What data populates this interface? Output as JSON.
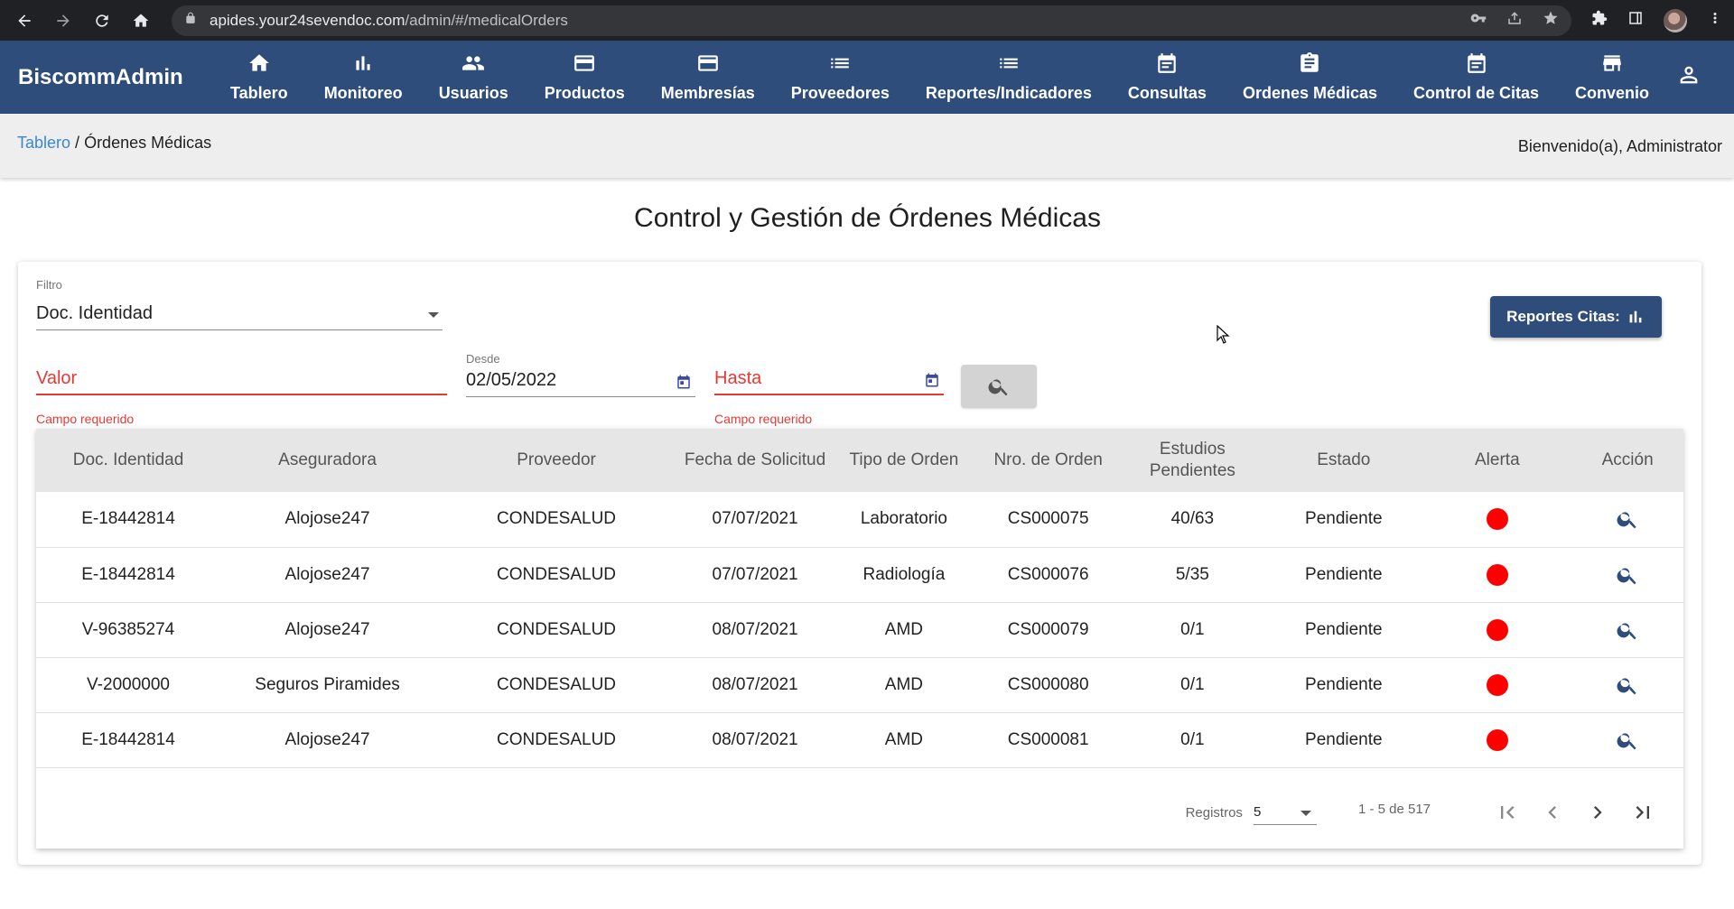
{
  "browser": {
    "url_host": "apides.your24sevendoc.com",
    "url_path": "/admin/#/medicalOrders"
  },
  "app": {
    "brand": "BiscommAdmin",
    "nav": [
      {
        "label": "Tablero",
        "icon": "home-icon"
      },
      {
        "label": "Monitoreo",
        "icon": "bar-chart-icon"
      },
      {
        "label": "Usuarios",
        "icon": "people-icon"
      },
      {
        "label": "Productos",
        "icon": "credit-card-icon"
      },
      {
        "label": "Membresías",
        "icon": "credit-card-icon"
      },
      {
        "label": "Proveedores",
        "icon": "list-icon"
      },
      {
        "label": "Reportes/Indicadores",
        "icon": "list-icon"
      },
      {
        "label": "Consultas",
        "icon": "calendar-icon"
      },
      {
        "label": "Ordenes Médicas",
        "icon": "clipboard-icon"
      },
      {
        "label": "Control de Citas",
        "icon": "calendar-icon"
      },
      {
        "label": "Convenio",
        "icon": "store-icon"
      }
    ]
  },
  "breadcrumb": {
    "home": "Tablero",
    "separator": " / ",
    "current": "Órdenes Médicas"
  },
  "welcome": "Bienvenido(a), Administrator",
  "page_title": "Control y Gestión de Órdenes Médicas",
  "filters": {
    "filter_label": "Filtro",
    "filter_value": "Doc. Identidad",
    "valor_placeholder": "Valor",
    "desde_label": "Desde",
    "desde_value": "02/05/2022",
    "hasta_placeholder": "Hasta",
    "required_msg": "Campo requerido",
    "report_button": "Reportes Citas:"
  },
  "table": {
    "headers": [
      "Doc. Identidad",
      "Aseguradora",
      "Proveedor",
      "Fecha de Solicitud",
      "Tipo de Orden",
      "Nro. de Orden",
      "Estudios Pendientes",
      "Estado",
      "Alerta",
      "Acción"
    ],
    "rows": [
      [
        "E-18442814",
        "Alojose247",
        "CONDESALUD",
        "07/07/2021",
        "Laboratorio",
        "CS000075",
        "40/63",
        "Pendiente"
      ],
      [
        "E-18442814",
        "Alojose247",
        "CONDESALUD",
        "07/07/2021",
        "Radiología",
        "CS000076",
        "5/35",
        "Pendiente"
      ],
      [
        "V-96385274",
        "Alojose247",
        "CONDESALUD",
        "08/07/2021",
        "AMD",
        "CS000079",
        "0/1",
        "Pendiente"
      ],
      [
        "V-2000000",
        "Seguros Piramides",
        "CONDESALUD",
        "08/07/2021",
        "AMD",
        "CS000080",
        "0/1",
        "Pendiente"
      ],
      [
        "E-18442814",
        "Alojose247",
        "CONDESALUD",
        "08/07/2021",
        "AMD",
        "CS000081",
        "0/1",
        "Pendiente"
      ]
    ],
    "alert_color": "#ff0000"
  },
  "pagination": {
    "label": "Registros",
    "page_size": "5",
    "range": "1 - 5 de 517"
  },
  "colors": {
    "brand": "#2e4d7b",
    "error": "#e53935",
    "link": "#3a86d4"
  }
}
